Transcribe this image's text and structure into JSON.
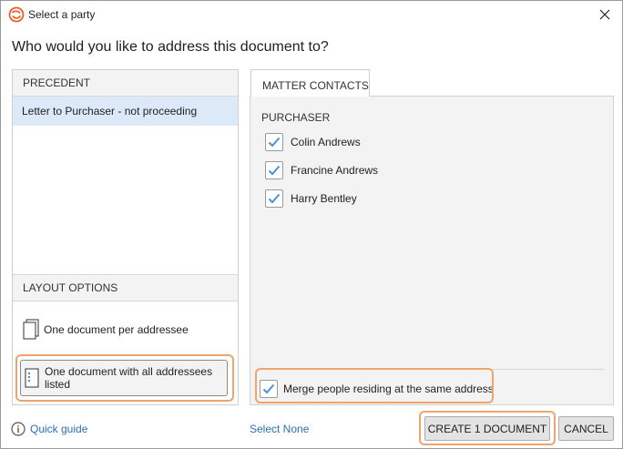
{
  "window": {
    "title": "Select a party",
    "close_symbol": "✕"
  },
  "heading": "Who would you like to address this document to?",
  "precedent": {
    "header": "PRECEDENT",
    "items": [
      "Letter to Purchaser - not proceeding"
    ]
  },
  "layout_options": {
    "header": "LAYOUT OPTIONS",
    "options": [
      {
        "label": "One document per addressee",
        "selected": false
      },
      {
        "label": "One document with all addressees listed",
        "selected": true
      }
    ]
  },
  "matter_contacts": {
    "tab_label": "MATTER CONTACTS",
    "group_label": "PURCHASER",
    "contacts": [
      {
        "name": "Colin Andrews",
        "checked": true
      },
      {
        "name": "Francine Andrews",
        "checked": true
      },
      {
        "name": "Harry Bentley",
        "checked": true
      }
    ],
    "merge_label": "Merge people residing at the same address",
    "merge_checked": true
  },
  "footer": {
    "quick_guide": "Quick guide",
    "select_none": "Select None",
    "create_button": "CREATE 1 DOCUMENT",
    "cancel_button": "CANCEL"
  },
  "colors": {
    "accent": "#4a90d9",
    "highlight": "#f0a46c",
    "link": "#2a6fb5",
    "selected_row": "#dbe9f8",
    "logo": "#e8602c"
  },
  "icons": {
    "logo": "app-logo-icon",
    "close": "close-icon",
    "info": "info-icon",
    "document": "document-icon",
    "check": "checkmark-icon"
  }
}
